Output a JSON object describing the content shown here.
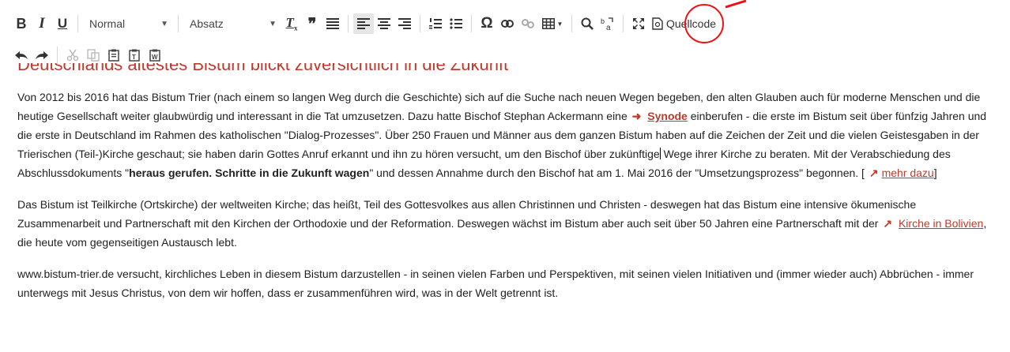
{
  "toolbar": {
    "bold_label": "B",
    "italic_label": "I",
    "underline_label": "U",
    "font_size_value": "Normal",
    "format_value": "Absatz",
    "source_label": "Quellcode",
    "icons": [
      "bold-icon",
      "italic-icon",
      "underline-icon",
      "remove-format-icon",
      "blockquote-icon",
      "justify-icon",
      "align-left-icon",
      "align-center-icon",
      "align-right-icon",
      "numbered-list-icon",
      "bulleted-list-icon",
      "special-char-icon",
      "link-icon",
      "unlink-icon",
      "table-icon",
      "find-icon",
      "replace-icon",
      "maximize-icon",
      "source-icon",
      "undo-icon",
      "redo-icon",
      "cut-icon",
      "copy-icon",
      "paste-icon",
      "paste-text-icon",
      "paste-word-icon"
    ],
    "special_char": "Ω",
    "quote_glyph": "❞",
    "highlight_color": "#e11111"
  },
  "doc": {
    "heading": "Deutschlands ältestes Bistum blickt zuversichtlich in die Zukunft",
    "p1": {
      "t1": "Von 2012 bis 2016 hat das Bistum Trier (nach einem so langen Weg durch die  Geschichte) sich auf die Suche nach neuen Wegen begeben, den alten Glauben auch für moderne Menschen und die heutige Gesellschaft weiter glaubwürdig und interessant in die Tat umzusetzen. Dazu hatte Bischof Stephan Ackermann eine ",
      "synode_arrow": "➜",
      "synode": "Synode",
      "t2": " einberufen - die erste im Bistum seit über fünfzig Jahren und die erste in Deutschland im Rahmen des katholischen \"Dialog-Prozesses\". Über 250 Frauen und Männer aus dem ganzen Bistum haben auf die Zeichen der Zeit und die vielen Geistesgaben in der Trierischen (Teil-)Kirche geschaut; sie haben darin Gottes Anruf erkannt und ihn zu hören versucht, um den Bischof über zukünftige",
      "t3": " Wege ihrer Kirche zu beraten. Mit der Verabschiedung des Abschlussdokuments \"",
      "bold": "heraus gerufen. Schritte in die Zukunft wagen",
      "t4": "\" und dessen Annahme durch den Bischof hat am 1. Mai 2016 der \"Umsetzungsprozess\" begonnen. [ ",
      "more_arrow": "↗",
      "more": "mehr dazu",
      "t5": "]"
    },
    "p2": {
      "t1": "Das Bistum ist Teilkirche (Ortskirche) der weltweiten Kirche; das heißt, Teil des Gottesvolkes aus allen Christinnen und Christen - deswegen hat das Bistum eine intensive ökumenische Zusammenarbeit und Partnerschaft mit den Kirchen der Orthodoxie und der Reformation. Deswegen wächst im Bistum aber auch seit über 50 Jahren eine Partnerschaft mit der ",
      "arrow": "↗",
      "link": "Kirche in Bolivien",
      "t2": ", die heute vom gegenseitigen Austausch lebt."
    },
    "p3": "www.bistum-trier.de versucht, kirchliches Leben in diesem Bistum darzustellen - in seinen vielen Farben und Perspektiven, mit seinen vielen Initiativen und (immer wieder auch) Abbrüchen - immer unterwegs mit Jesus Christus, von dem wir hoffen, dass er zusammenführen wird, was in der Welt getrennt ist."
  }
}
